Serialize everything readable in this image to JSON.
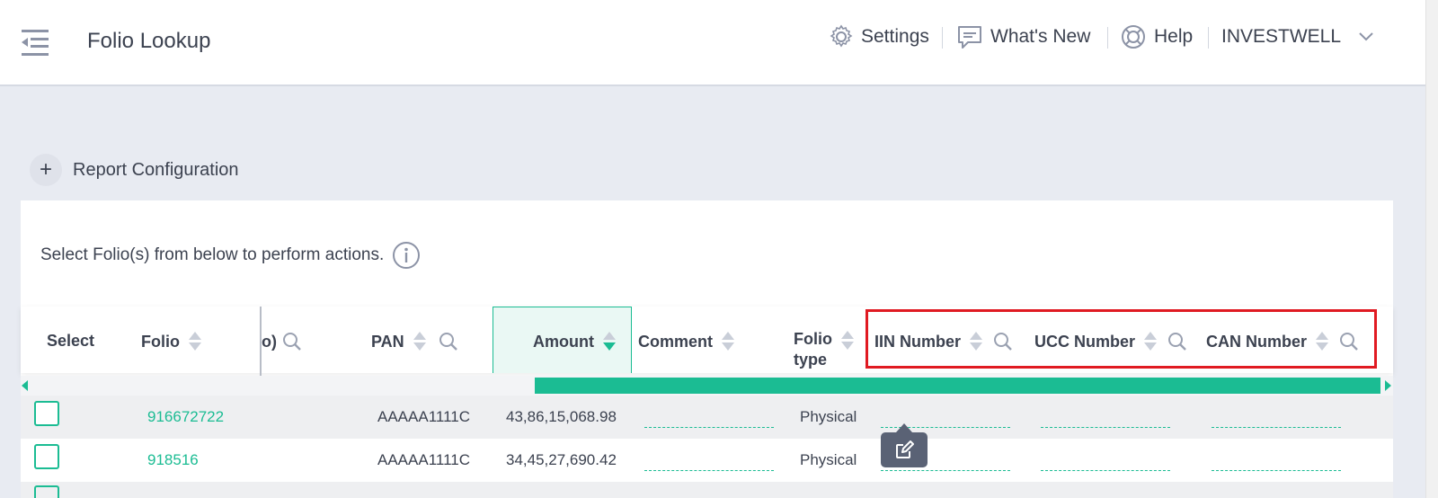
{
  "header": {
    "title": "Folio Lookup",
    "nav": {
      "settings": "Settings",
      "whats_new": "What's New",
      "help": "Help",
      "user": "INVESTWELL"
    }
  },
  "report_config": {
    "label": "Report Configuration"
  },
  "hint": "Select Folio(s) from below to perform actions.",
  "table": {
    "columns": {
      "select": "Select",
      "folio": "Folio",
      "partial": "o)",
      "pan": "PAN",
      "amount": "Amount",
      "comment": "Comment",
      "folio_type_1": "Folio",
      "folio_type_2": "type",
      "iin": "IIN Number",
      "ucc": "UCC Number",
      "can": "CAN Number"
    },
    "rows": [
      {
        "folio": "916672722",
        "pan": "AAAAA1111C",
        "amount": "43,86,15,068.98",
        "folio_type": "Physical"
      },
      {
        "folio": "918516",
        "pan": "AAAAA1111C",
        "amount": "34,45,27,690.42",
        "folio_type": "Physical"
      }
    ]
  },
  "colors": {
    "accent": "#1bbc93",
    "highlight": "#e01a22",
    "text": "#3c4250"
  }
}
